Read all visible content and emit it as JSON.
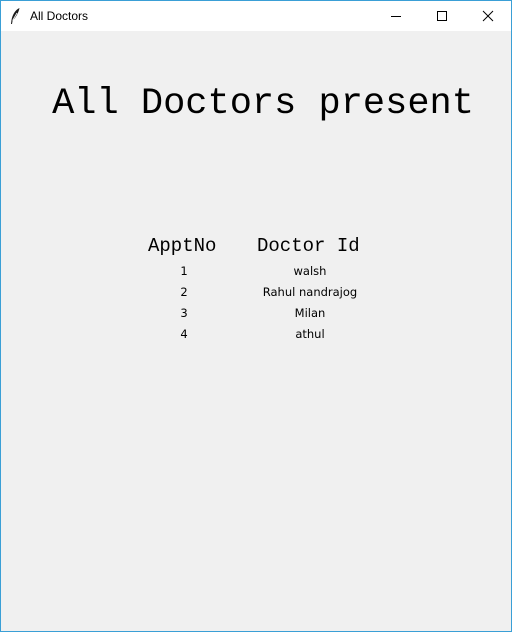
{
  "window": {
    "title": "All Doctors",
    "controls": {
      "minimize_icon": "minimize-icon",
      "maximize_icon": "maximize-icon",
      "close_icon": "close-icon"
    },
    "accent_color": "#3a9fd6",
    "background_color": "#f0f0f0"
  },
  "main": {
    "heading": "All Doctors present",
    "table": {
      "headers": [
        "ApptNo",
        "Doctor Id"
      ],
      "rows": [
        {
          "appt_no": "1",
          "doctor_id": "walsh"
        },
        {
          "appt_no": "2",
          "doctor_id": "Rahul nandrajog"
        },
        {
          "appt_no": "3",
          "doctor_id": "Milan"
        },
        {
          "appt_no": "4",
          "doctor_id": "athul"
        }
      ]
    }
  }
}
